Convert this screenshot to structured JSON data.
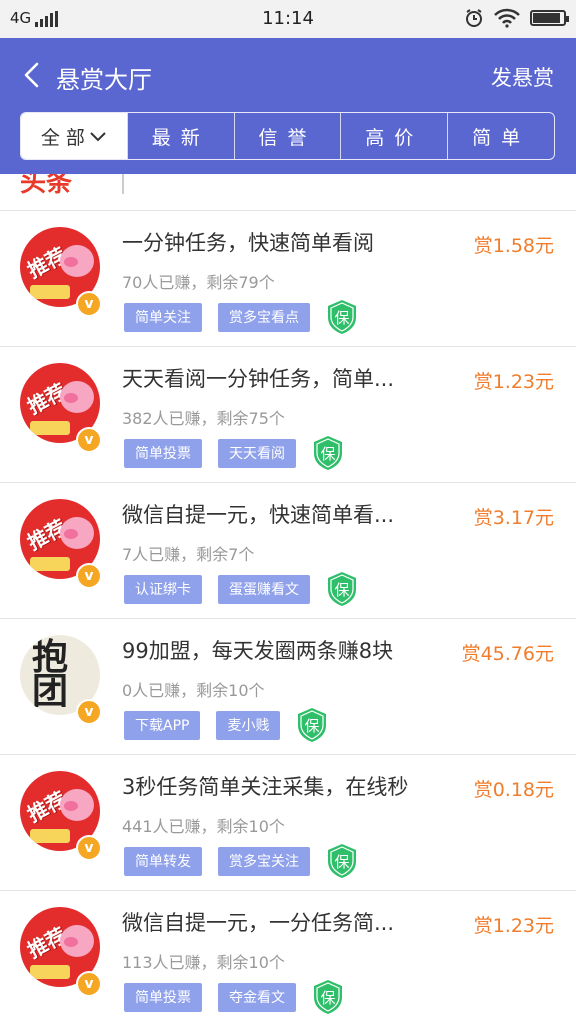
{
  "status": {
    "network": "4G",
    "time": "11:14"
  },
  "header": {
    "title": "悬赏大厅",
    "action": "发悬赏"
  },
  "tabs": [
    "全部",
    "最新",
    "信誉",
    "高价",
    "简单"
  ],
  "partial": {
    "label": "头条"
  },
  "items": [
    {
      "title": "一分钟任务，快速简单看阅",
      "reward": "赏1.58元",
      "stats": "70人已赚，剩余79个",
      "tags": [
        "简单关注",
        "赏多宝看点"
      ],
      "avatar": "推荐"
    },
    {
      "title": "天天看阅一分钟任务，简单...",
      "reward": "赏1.23元",
      "stats": "382人已赚，剩余75个",
      "tags": [
        "简单投票",
        "天天看阅"
      ],
      "avatar": "推荐"
    },
    {
      "title": "微信自提一元，快速简单看...",
      "reward": "赏3.17元",
      "stats": "7人已赚，剩余7个",
      "tags": [
        "认证绑卡",
        "蛋蛋赚看文"
      ],
      "avatar": "推荐"
    },
    {
      "title": "99加盟，每天发圈两条赚8块",
      "reward": "赏45.76元",
      "stats": "0人已赚，剩余10个",
      "tags": [
        "下载APP",
        "麦小贱"
      ],
      "avatar": "抱团"
    },
    {
      "title": "3秒任务简单关注采集，在线秒",
      "reward": "赏0.18元",
      "stats": "441人已赚，剩余10个",
      "tags": [
        "简单转发",
        "赏多宝关注"
      ],
      "avatar": "推荐"
    },
    {
      "title": "微信自提一元，一分任务简...",
      "reward": "赏1.23元",
      "stats": "113人已赚，剩余10个",
      "tags": [
        "简单投票",
        "夺金看文"
      ],
      "avatar": "推荐"
    }
  ],
  "shield_label": "保",
  "vip_label": "v",
  "colors": {
    "header": "#5b67d0",
    "reward": "#f07d2c",
    "tag": "#8fa1ea",
    "shield": "#2fbf6a"
  },
  "icons": [
    "back-arrow-icon",
    "chevron-down-icon",
    "alarm-icon",
    "wifi-icon",
    "battery-icon",
    "shield-icon"
  ]
}
